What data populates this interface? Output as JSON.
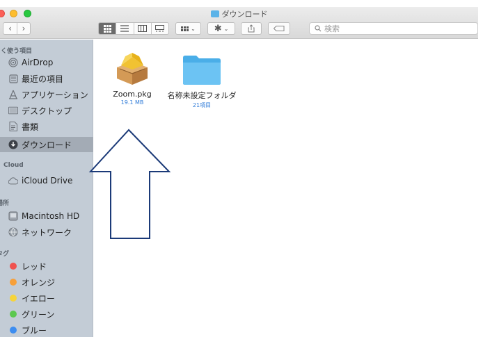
{
  "window": {
    "title": "ダウンロード"
  },
  "toolbar": {
    "back": "‹",
    "forward": "›",
    "search_placeholder": "検索"
  },
  "sidebar": {
    "sections": {
      "favorites": "よく使う項目",
      "icloud": "Cloud",
      "locations": "場所",
      "tags": "タグ"
    },
    "favorites": [
      {
        "label": "AirDrop",
        "icon": "airdrop-icon"
      },
      {
        "label": "最近の項目",
        "icon": "recents-icon"
      },
      {
        "label": "アプリケーション",
        "icon": "applications-icon"
      },
      {
        "label": "デスクトップ",
        "icon": "desktop-icon"
      },
      {
        "label": "書類",
        "icon": "documents-icon"
      },
      {
        "label": "ダウンロード",
        "icon": "downloads-icon",
        "selected": true
      }
    ],
    "icloud": [
      {
        "label": "iCloud Drive",
        "icon": "cloud-icon"
      }
    ],
    "locations": [
      {
        "label": "Macintosh HD",
        "icon": "harddisk-icon"
      },
      {
        "label": "ネットワーク",
        "icon": "network-icon"
      }
    ],
    "tags": [
      {
        "label": "レッド",
        "color": "#f0524f"
      },
      {
        "label": "オレンジ",
        "color": "#f7a03a"
      },
      {
        "label": "イエロー",
        "color": "#f6d43b"
      },
      {
        "label": "グリーン",
        "color": "#5cc84f"
      },
      {
        "label": "ブルー",
        "color": "#3d8df0"
      }
    ]
  },
  "files": [
    {
      "name": "Zoom.pkg",
      "meta": "19.1 MB",
      "icon": "package-icon"
    },
    {
      "name": "名称未設定フォルダ",
      "meta": "21項目",
      "icon": "folder-icon"
    }
  ],
  "colors": {
    "sidebar_bg": "#c3ccd6",
    "selected_bg": "#a3abb5",
    "meta_blue": "#2f7bd8",
    "arrow_stroke": "#1b3a78"
  }
}
